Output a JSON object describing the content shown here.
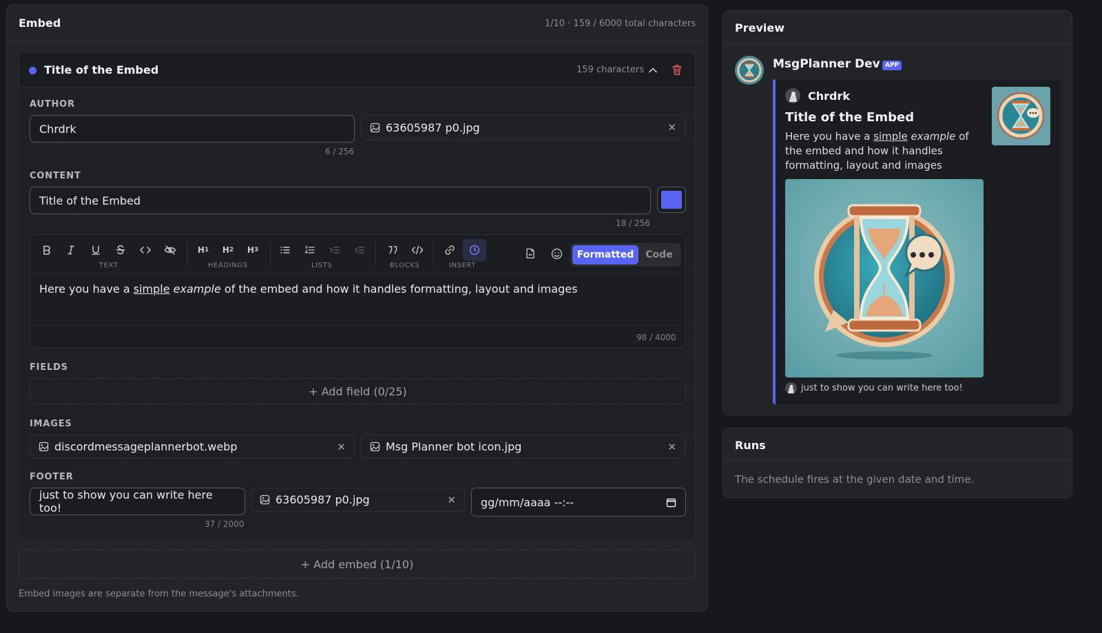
{
  "editor": {
    "title": "Embed",
    "stats": "1/10 · 159 / 6000 total characters",
    "embed_card": {
      "title": "Title of the Embed",
      "char_count": "159 characters",
      "dot_color": "#5865f2"
    },
    "author": {
      "label": "AUTHOR",
      "name_value": "Chrdrk",
      "name_counter": "6 / 256",
      "icon_file": "63605987 p0.jpg"
    },
    "content": {
      "label": "CONTENT",
      "title_value": "Title of the Embed",
      "title_counter": "18 / 256",
      "color_swatch": "#5865f2",
      "toolbar": {
        "groups": [
          "TEXT",
          "HEADINGS",
          "LISTS",
          "BLOCKS",
          "INSERT"
        ],
        "mode_formatted": "Formatted",
        "mode_code": "Code"
      },
      "body": {
        "before": "Here you have a ",
        "underline": "simple",
        "space": " ",
        "italic": "example",
        "after": " of the embed and how it handles formatting, layout and images"
      },
      "body_counter": "98 / 4000"
    },
    "fields": {
      "label": "FIELDS",
      "add_label": "+ Add field (0/25)"
    },
    "images": {
      "label": "IMAGES",
      "image_file": "discordmessageplannerbot.webp",
      "thumbnail_file": "Msg Planner bot icon.jpg"
    },
    "footer": {
      "label": "FOOTER",
      "text_value": "just to show you can write here too!",
      "text_counter": "37 / 2000",
      "icon_file": "63605987 p0.jpg",
      "timestamp_placeholder": "gg/mm/aaaa --:--"
    },
    "add_embed": "+ Add embed (1/10)",
    "note": "Embed images are separate from the message's attachments."
  },
  "preview": {
    "title": "Preview",
    "bot_name": "MsgPlanner Dev",
    "bot_badge": "APP",
    "embed": {
      "author": "Chrdrk",
      "title": "Title of the Embed",
      "desc_before": "Here you have a ",
      "desc_underline": "simple",
      "desc_italic": "example",
      "desc_after": " of the embed and how it handles formatting, layout and images",
      "footer": "just to show you can write here too!",
      "accent_color": "#5865f2"
    }
  },
  "runs": {
    "title": "Runs",
    "description": "The schedule fires at the given date and time."
  }
}
